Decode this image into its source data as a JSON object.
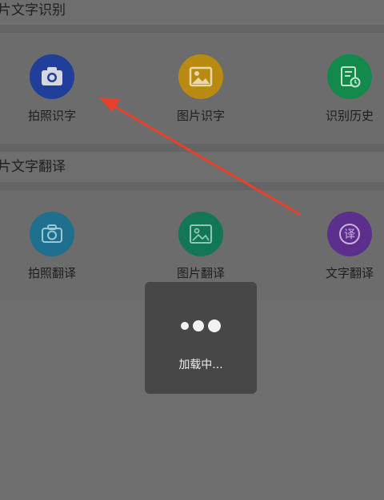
{
  "sections": [
    {
      "title": "片文字识别",
      "items": [
        {
          "label": "拍照识字",
          "icon": "camera-icon",
          "color": "#1f3f9a"
        },
        {
          "label": "图片识字",
          "icon": "image-icon",
          "color": "#b98a12"
        },
        {
          "label": "识别历史",
          "icon": "history-document-icon",
          "color": "#118a4c"
        }
      ]
    },
    {
      "title": "片文字翻译",
      "items": [
        {
          "label": "拍照翻译",
          "icon": "camera-translate-icon",
          "color": "#1f6f8e"
        },
        {
          "label": "图片翻译",
          "icon": "image-translate-icon",
          "color": "#137656"
        },
        {
          "label": "文字翻译",
          "icon": "text-translate-icon",
          "color": "#5c2f8c"
        }
      ]
    }
  ],
  "toast": {
    "text": "加载中...",
    "icon": "loading-dots-icon"
  },
  "annotation": {
    "arrow_color": "#e8402a"
  }
}
